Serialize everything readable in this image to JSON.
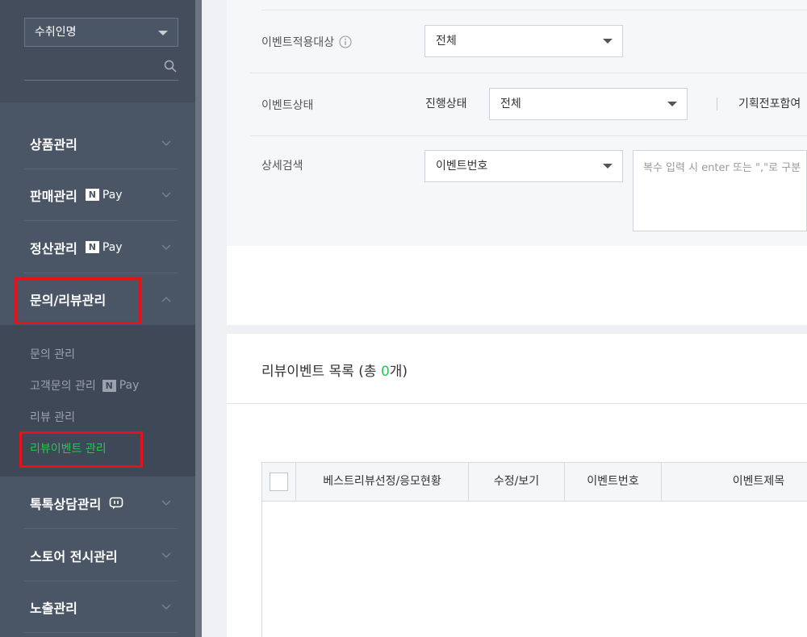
{
  "sidebar": {
    "store_select": "수취인명",
    "menu": [
      {
        "label": "상품관리",
        "npay": false
      },
      {
        "label": "판매관리",
        "npay": true
      },
      {
        "label": "정산관리",
        "npay": true
      },
      {
        "label": "문의/리뷰관리",
        "npay": false
      },
      {
        "label": "톡톡상담관리",
        "npay": false
      },
      {
        "label": "스토어 전시관리",
        "npay": false
      },
      {
        "label": "노출관리",
        "npay": false
      }
    ],
    "npay_label": "Pay",
    "npay_letter": "N",
    "sub_items": [
      {
        "label": "문의 관리"
      },
      {
        "label": "고객문의 관리"
      },
      {
        "label": "리뷰 관리"
      },
      {
        "label": "리뷰이벤트 관리"
      }
    ]
  },
  "filters": {
    "target_label": "이벤트적용대상",
    "target_value": "전체",
    "status_label": "이벤트상태",
    "progress_label": "진행상태",
    "progress_value": "전체",
    "plan_label": "기획전포함여",
    "detail_label": "상세검색",
    "detail_select": "이벤트번호",
    "detail_placeholder": "복수 입력 시 enter 또는 \",\"로 구분"
  },
  "list": {
    "title_prefix": "리뷰이벤트 목록 (총 ",
    "count": "0",
    "title_suffix": "개)",
    "columns": [
      "베스트리뷰선정/응모현황",
      "수정/보기",
      "이벤트번호",
      "이벤트제목"
    ]
  },
  "colors": {
    "accent_green": "#2dc15a",
    "highlight_red": "#e3121b",
    "sidebar_bg": "#4a5566"
  }
}
